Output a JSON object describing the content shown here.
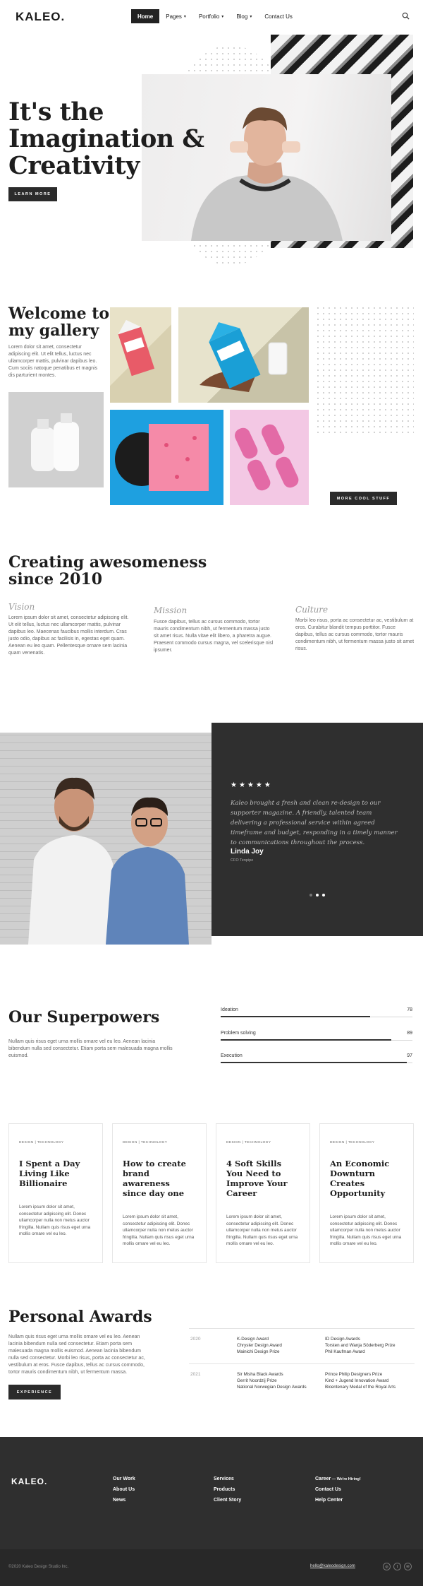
{
  "header": {
    "logo": "KALEO.",
    "nav": [
      {
        "label": "Home",
        "caret": ""
      },
      {
        "label": "Pages",
        "caret": "▾"
      },
      {
        "label": "Portfolio",
        "caret": "▾"
      },
      {
        "label": "Blog",
        "caret": "▾"
      },
      {
        "label": "Contact Us",
        "caret": ""
      }
    ]
  },
  "hero": {
    "title_line1": "It's the",
    "title_line2": "Imagination &",
    "title_line3": "Creativity",
    "button": "LEARN MORE"
  },
  "gallery": {
    "title_line1": "Welcome to",
    "title_line2": "my gallery",
    "text": "Lorem dolor sit amet, consectetur adipiscing elit. Ut elit tellus, luctus nec ullamcorper mattis, pulvinar dapibus leo. Cum sociis natoque penatibus et magnis dis parturient montes.",
    "button": "MORE COOL STUFF"
  },
  "creating": {
    "title_line1": "Creating awesomeness",
    "title_line2": "since 2010",
    "columns": [
      {
        "head": "Vision",
        "text": "Lorem ipsum dolor sit amet, consectetur adipiscing elit. Ut elit tellus, luctus nec ullamcorper mattis, pulvinar dapibus leo. Maecenas faucibus mollis interdum. Cras justo odio, dapibus ac facilisis in, egestas eget quam. Aenean eu leo quam. Pellentesque ornare sem lacinia quam venenatis."
      },
      {
        "head": "Mission",
        "text": "Fusce dapibus, tellus ac cursus commodo, tortor mauris condimentum nibh, ut fermentum massa justo sit amet risus. Nulla vitae elit libero, a pharetra augue. Praesent commodo cursus magna, vel scelerisque nisl ipsumer."
      },
      {
        "head": "Culture",
        "text": "Morbi leo risus, porta ac consectetur ac, vestibulum at eros. Curabitur blandit tempus porttitor. Fusce dapibus, tellus ac cursus commodo, tortor mauris condimentum nibh, ut fermentum massa justo sit amet risus."
      }
    ]
  },
  "testimonial": {
    "stars": "★★★★★",
    "quote": "Kaleo brought a fresh and clean re-design to our supporter magazine. A friendly, talented team delivering a professional service within agreed timeframe and budget, responding in a timely manner to communications throughout the process.",
    "name": "Linda Joy",
    "role": "CFO Tenpipe"
  },
  "superpowers": {
    "title": "Our Superpowers",
    "text": "Nullam quis risus eget urna mollis ornare vel eu leo. Aenean lacinia bibendum nulla sed consectetur. Etiam porta sem malesuada magna mollis euismod.",
    "bars": [
      {
        "label": "Ideation",
        "value": "78",
        "percent": 78
      },
      {
        "label": "Problem solving",
        "value": "89",
        "percent": 89
      },
      {
        "label": "Execution",
        "value": "97",
        "percent": 97
      }
    ]
  },
  "cards": [
    {
      "tag": "DESIGN | TECHNOLOGY",
      "title": "I Spent a Day Living Like Billionaire",
      "text": "Lorem ipsum dolor sit amet, consectetur adipiscing elit. Donec ullamcorper nulla non metus auctor fringilla. Nullam quis risus eget urna mollis ornare vel eu leo."
    },
    {
      "tag": "DESIGN | TECHNOLOGY",
      "title": "How to create brand awareness since day one",
      "text": "Lorem ipsum dolor sit amet, consectetur adipiscing elit. Donec ullamcorper nulla non metus auctor fringilla. Nullam quis risus eget urna mollis ornare vel eu leo."
    },
    {
      "tag": "DESIGN | TECHNOLOGY",
      "title": "4 Soft Skills You Need to Improve Your Career",
      "text": "Lorem ipsum dolor sit amet, consectetur adipiscing elit. Donec ullamcorper nulla non metus auctor fringilla. Nullam quis risus eget urna mollis ornare vel eu leo."
    },
    {
      "tag": "DESIGN | TECHNOLOGY",
      "title": "An Economic Downturn Creates Opportunity",
      "text": "Lorem ipsum dolor sit amet, consectetur adipiscing elit. Donec ullamcorper nulla non metus auctor fringilla. Nullam quis risus eget urna mollis ornare vel eu leo."
    }
  ],
  "awards": {
    "title": "Personal Awards",
    "text": "Nullam quis risus eget urna mollis ornare vel eu leo. Aenean lacinia bibendum nulla sed consectetur. Etiam porta sem malesuada magna mollis euismod. Aenean lacinia bibendum nulla sed consectetur. Morbi leo risus, porta ac consectetur ac, vestibulum at eros. Fusce dapibus, tellus ac cursus commodo, tortor mauris condimentum nibh, ut fermentum massa.",
    "button": "EXPERIENCE",
    "rows": [
      {
        "year": "2020",
        "col1": [
          "K-Design Award",
          "Chrysler Design Award",
          "Mainichi Design Prize"
        ],
        "col2": [
          "ID Design Awards",
          "Torsten and Wanja Söderberg Prize",
          "Phil Kaufman Award"
        ]
      },
      {
        "year": "2021",
        "col1": [
          "Sir Misha Black Awards",
          "Gerrit Noordzij Prize",
          "National Norwegian Design Awards"
        ],
        "col2": [
          "Prince Philip Designers Prize",
          "Kind + Jugend Innovation Award",
          "Bicentenary Medal of the Royal Arts"
        ]
      }
    ]
  },
  "footer": {
    "logo": "KALEO.",
    "col1": [
      "Our Work",
      "About Us",
      "News"
    ],
    "col2": [
      "Services",
      "Products",
      "Client Story"
    ],
    "col3_first": "Career",
    "col3_hiring": " — We're Hiring!",
    "col3": [
      "Contact Us",
      "Help Center"
    ],
    "copyright": "©2020 Kaleo Design Studio Inc.",
    "email": "hello@kaleodesign.com",
    "social": [
      "◎",
      "t",
      "✉"
    ]
  },
  "colors": {
    "dark": "#2f2f2f",
    "accent_pink": "#e75a6a",
    "accent_blue": "#1aa0d8"
  }
}
